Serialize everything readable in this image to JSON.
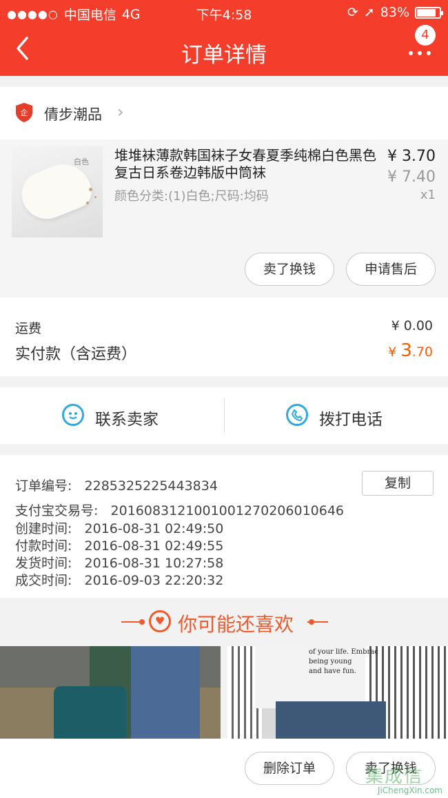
{
  "status_bar": {
    "carrier": "中国电信",
    "network": "4G",
    "time": "下午4:58",
    "battery_percent": "83%",
    "battery_level": 0.83
  },
  "nav": {
    "title": "订单详情",
    "badge_count": "4"
  },
  "shop": {
    "name": "倩步潮品"
  },
  "item": {
    "title": "堆堆袜薄款韩国袜子女春夏季纯棉白色黑色复古日系卷边韩版中筒袜",
    "sku": "颜色分类:(1)白色;尺码:均码",
    "price": "¥ 3.70",
    "original_price": "¥ 7.40",
    "quantity": "x1",
    "thumb_label": "白色",
    "actions": [
      "卖了换钱",
      "申请售后"
    ]
  },
  "fees": {
    "shipping_label": "运费",
    "shipping_value": "¥ 0.00",
    "total_label": "实付款（含运费）",
    "total_currency": "¥ ",
    "total_int": "3",
    "total_dec": ".70"
  },
  "contact": {
    "seller_label": "联系卖家",
    "call_label": "拨打电话"
  },
  "order_info": {
    "order_no_label": "订单编号:",
    "order_no": "2285325225443834",
    "copy_label": "复制",
    "alipay_label": "支付宝交易号:",
    "alipay_no": "2016083121001001270206010646",
    "created_label": "创建时间:",
    "created": "2016-08-31 02:49:50",
    "paid_label": "付款时间:",
    "paid": "2016-08-31 02:49:55",
    "shipped_label": "发货时间:",
    "shipped": "2016-08-31 10:27:58",
    "done_label": "成交时间:",
    "done": "2016-09-03 22:20:32"
  },
  "recommend": {
    "title": "你可能还喜欢",
    "shirt_text": [
      "of your life. Embrac",
      "being young",
      "and have fun."
    ]
  },
  "bottom_bar": {
    "delete_label": "删除订单",
    "sell_label": "卖了换钱"
  },
  "watermark": {
    "site": "JiChengXin.com"
  },
  "colors": {
    "brand_red": "#f43d2b",
    "price_orange": "#ff5a00",
    "accent_orange": "#f05a2a",
    "icon_blue": "#2fa9e1"
  }
}
